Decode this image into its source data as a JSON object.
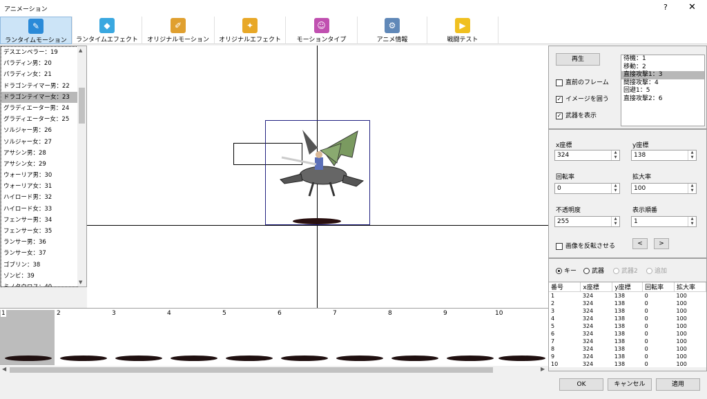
{
  "window": {
    "title": "アニメーション",
    "help": "?",
    "close": "✕"
  },
  "toolbar": {
    "buttons": [
      {
        "label": "ランタイムモーション",
        "icon": "pen-icon",
        "color": "#2a8ad8"
      },
      {
        "label": "ランタイムエフェクト",
        "icon": "crystal-icon",
        "color": "#3aa8e0"
      },
      {
        "label": "オリジナルモーション",
        "icon": "brush-icon",
        "color": "#e0a030"
      },
      {
        "label": "オリジナルエフェクト",
        "icon": "spark-icon",
        "color": "#e8a828"
      },
      {
        "label": "モーションタイプ",
        "icon": "people-icon",
        "color": "#c050b0"
      },
      {
        "label": "アニメ情報",
        "icon": "gear-icon",
        "color": "#6088b8"
      },
      {
        "label": "戦闘テスト",
        "icon": "play-icon",
        "color": "#f0c020"
      }
    ]
  },
  "character_list": {
    "items": [
      "デスエンペラー：19",
      "パラディン男：20",
      "パラディン女：21",
      "ドラゴンテイマー男：22",
      "ドラゴンテイマー女：23",
      "グラディエーター男：24",
      "グラディエーター女：25",
      "ソルジャー男：26",
      "ソルジャー女：27",
      "アサシン男：28",
      "アサシン女：29",
      "ウォーリア男：30",
      "ウォーリア女：31",
      "ハイロード男：32",
      "ハイロード女：33",
      "フェンサー男：34",
      "フェンサー女：35",
      "ランサー男：36",
      "ランサー女：37",
      "ゴブリン：38",
      "ゾンビ：39",
      "ミノタウロス：40"
    ],
    "selected": 4
  },
  "frames": {
    "numbers": [
      "1",
      "2",
      "3",
      "4",
      "5",
      "6",
      "7",
      "8",
      "9",
      "10"
    ],
    "selected": 0
  },
  "controls": {
    "play_label": "再生",
    "prev_frame_label": "直前のフレーム",
    "prev_frame_checked": false,
    "enclose_image_label": "イメージを囲う",
    "enclose_image_checked": true,
    "show_weapon_label": "武器を表示",
    "show_weapon_checked": true,
    "motion_types": [
      "待機：1",
      "移動：2",
      "直接攻撃1：3",
      "間接攻撃：4",
      "回避1：5",
      "直接攻撃2：6"
    ],
    "motion_selected": 2
  },
  "fields": {
    "x_label": "x座標",
    "x_value": "324",
    "y_label": "y座標",
    "y_value": "138",
    "rotation_label": "回転率",
    "rotation_value": "0",
    "scale_label": "拡大率",
    "scale_value": "100",
    "opacity_label": "不透明度",
    "opacity_value": "255",
    "order_label": "表示順番",
    "order_value": "1",
    "flip_label": "画像を反転させる",
    "flip_checked": false,
    "prev_btn": "<",
    "next_btn": ">"
  },
  "target": {
    "options": [
      {
        "label": "キー",
        "selected": true,
        "enabled": true
      },
      {
        "label": "武器",
        "selected": false,
        "enabled": true
      },
      {
        "label": "武器2",
        "selected": false,
        "enabled": false
      },
      {
        "label": "追加",
        "selected": false,
        "enabled": false
      }
    ]
  },
  "table": {
    "headers": [
      "番号",
      "x座標",
      "y座標",
      "回転率",
      "拡大率"
    ],
    "rows": [
      [
        "1",
        "324",
        "138",
        "0",
        "100"
      ],
      [
        "2",
        "324",
        "138",
        "0",
        "100"
      ],
      [
        "3",
        "324",
        "138",
        "0",
        "100"
      ],
      [
        "4",
        "324",
        "138",
        "0",
        "100"
      ],
      [
        "5",
        "324",
        "138",
        "0",
        "100"
      ],
      [
        "6",
        "324",
        "138",
        "0",
        "100"
      ],
      [
        "7",
        "324",
        "138",
        "0",
        "100"
      ],
      [
        "8",
        "324",
        "138",
        "0",
        "100"
      ],
      [
        "9",
        "324",
        "138",
        "0",
        "100"
      ],
      [
        "10",
        "324",
        "138",
        "0",
        "100"
      ]
    ]
  },
  "footer": {
    "ok": "OK",
    "cancel": "キャンセル",
    "apply": "適用"
  }
}
